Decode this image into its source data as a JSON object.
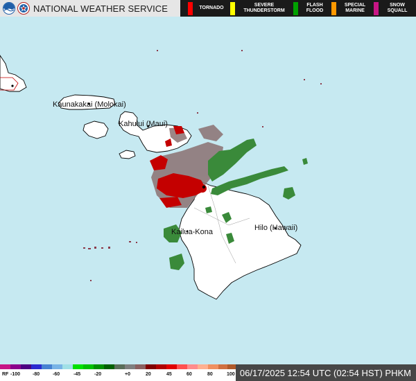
{
  "header": {
    "brand_name": "NATIONAL WEATHER SERVICE",
    "noaa_logo_icon": "noaa-logo-icon",
    "nws_logo_icon": "nws-logo-icon",
    "legend": [
      {
        "label": "TORNADO",
        "color": "#ff0000"
      },
      {
        "label": "SEVERE\nTHUNDERSTORM",
        "color": "#ffff00"
      },
      {
        "label": "FLASH\nFLOOD",
        "color": "#00a000"
      },
      {
        "label": "SPECIAL\nMARINE",
        "color": "#ff9900"
      },
      {
        "label": "SNOW\nSQUALL",
        "color": "#c71585"
      }
    ]
  },
  "map": {
    "water_color": "#c6e9f1",
    "land_color": "#ffffff",
    "labels": {
      "kaunakakai": "Kaunakakai (Molokai)",
      "kahului": "Kahului (Maui)",
      "kailua_kona": "Kailua-Kona",
      "hilo": "Hilo (Hawaii)"
    }
  },
  "bottom": {
    "scale": {
      "prefix": "RF",
      "ticks": [
        "-100",
        "-80",
        "-60",
        "-45",
        "-20",
        "+0",
        "20",
        "45",
        "60",
        "80",
        "100"
      ]
    },
    "timestamp": "06/17/2025 12:54 UTC (02:54 HST) PHKM"
  }
}
